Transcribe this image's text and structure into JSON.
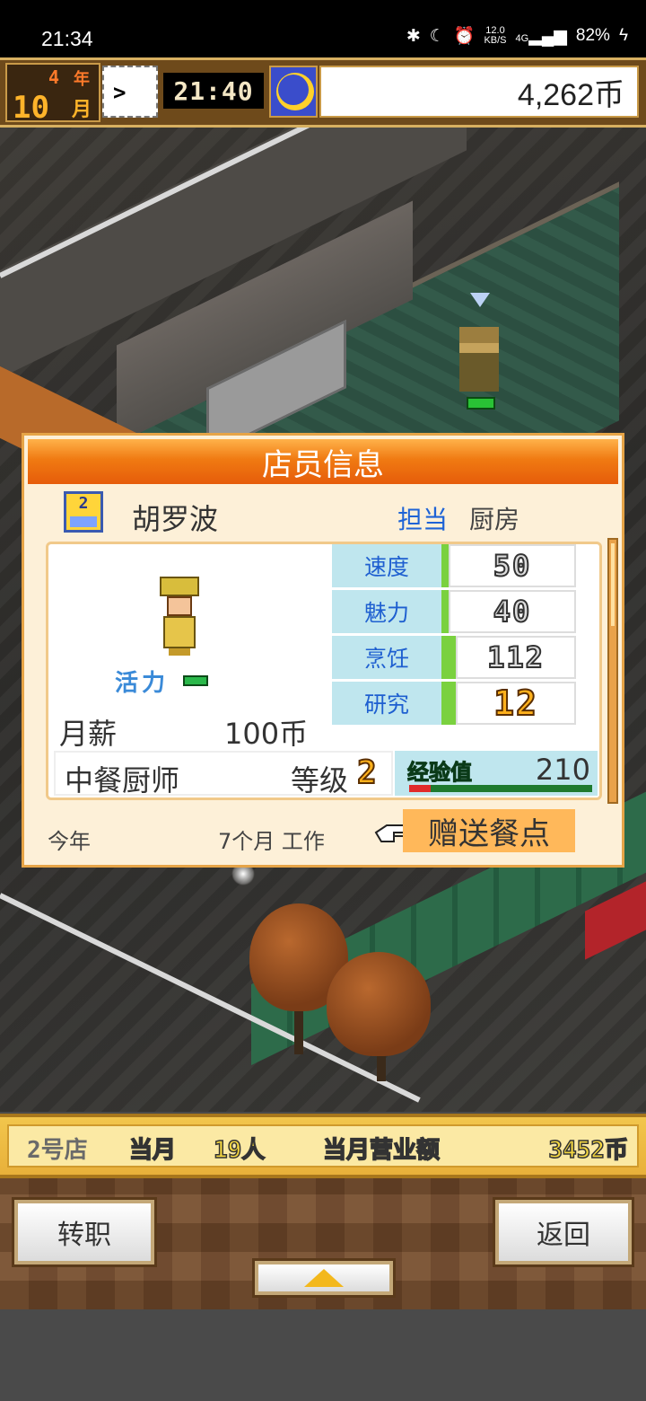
{
  "status_bar": {
    "time": "21:34",
    "network_speed_value": "12.0",
    "network_speed_unit": "KB/S",
    "signal": "4G",
    "battery": "82%",
    "icons": [
      "bluetooth-icon",
      "moon-icon",
      "alarm-icon",
      "signal-icon",
      "charging-icon"
    ]
  },
  "hud": {
    "year_value": "4",
    "year_label": "年",
    "month_value": "10",
    "month_label": "月",
    "speed_symbol": ">",
    "time": "21:40",
    "money": "4,262币"
  },
  "dialog": {
    "title": "店员信息",
    "rank": "2",
    "name": "胡罗波",
    "assign_label": "担当",
    "assign_value": "厨房",
    "vitality_label": "活力",
    "salary_label": "月薪",
    "salary_value": "100币",
    "stats": [
      {
        "name": "速度",
        "value": "50"
      },
      {
        "name": "魅力",
        "value": "40"
      },
      {
        "name": "烹饪",
        "value": "112"
      },
      {
        "name": "研究",
        "value": "12"
      }
    ],
    "job": "中餐厨师",
    "level_label": "等级",
    "level_value": "2",
    "exp_label": "经验值",
    "exp_value": "210",
    "exp_progress": 0.12,
    "footer_this_year": "今年",
    "footer_months": "7个月 工作",
    "gift_button": "赠送餐点"
  },
  "info_bar": {
    "shop": "2号店",
    "month_label": "当月",
    "customer_count": "19人",
    "sales_label": "当月营业额",
    "sales_value": "3452币"
  },
  "buttons": {
    "transfer": "转职",
    "back": "返回"
  },
  "colors": {
    "title_orange": "#f07a12",
    "stat_blue": "#1e5fd0",
    "gold": "#ffb11c",
    "vitality_green": "#2ab84a"
  }
}
